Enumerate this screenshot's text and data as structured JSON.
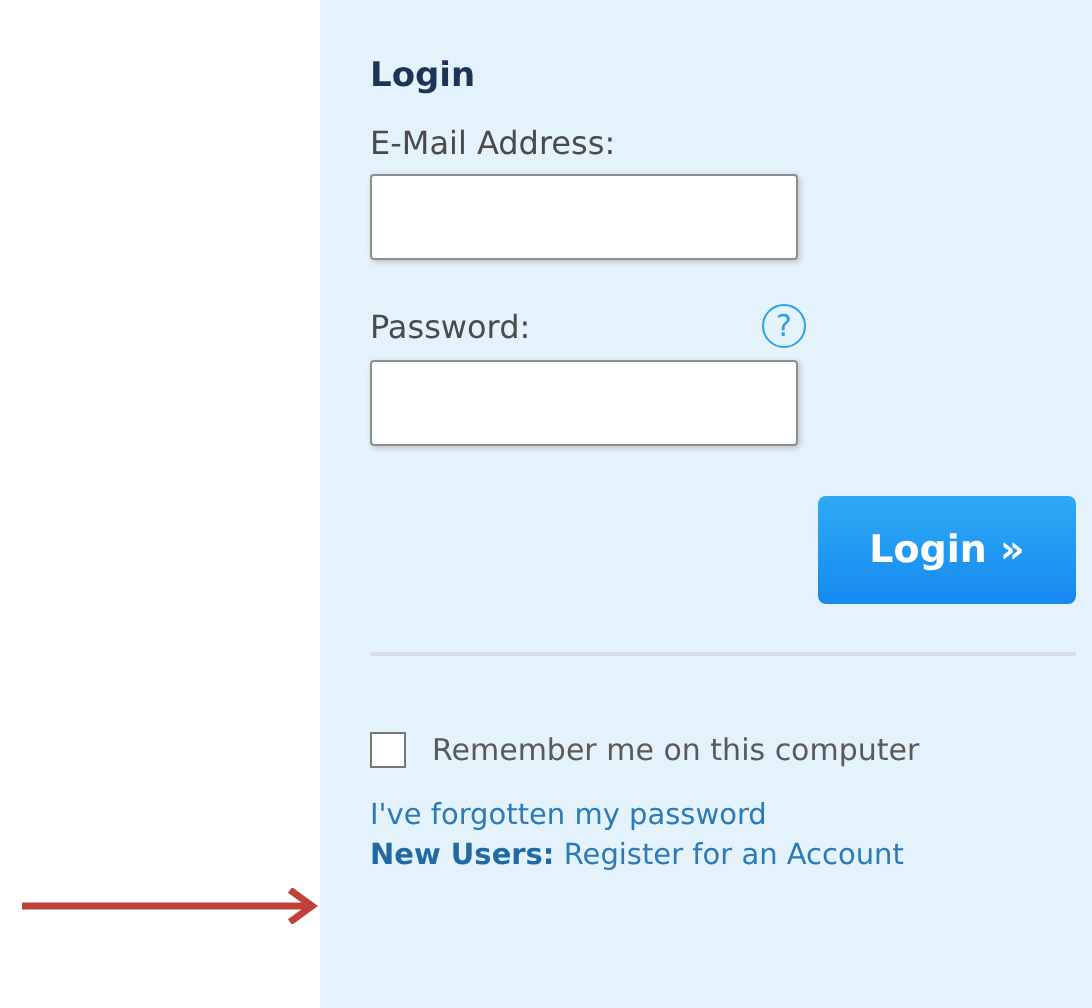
{
  "login_panel": {
    "title": "Login",
    "email": {
      "label": "E-Mail Address:"
    },
    "password": {
      "label": "Password:",
      "help": "?"
    },
    "submit": "Login »",
    "remember": {
      "label": "Remember me on this computer",
      "checked": false
    },
    "links": [
      "I've forgotten my password",
      "**New Users:** Register for an Account"
    ]
  },
  "annotation": {
    "kind": "arrow"
  }
}
